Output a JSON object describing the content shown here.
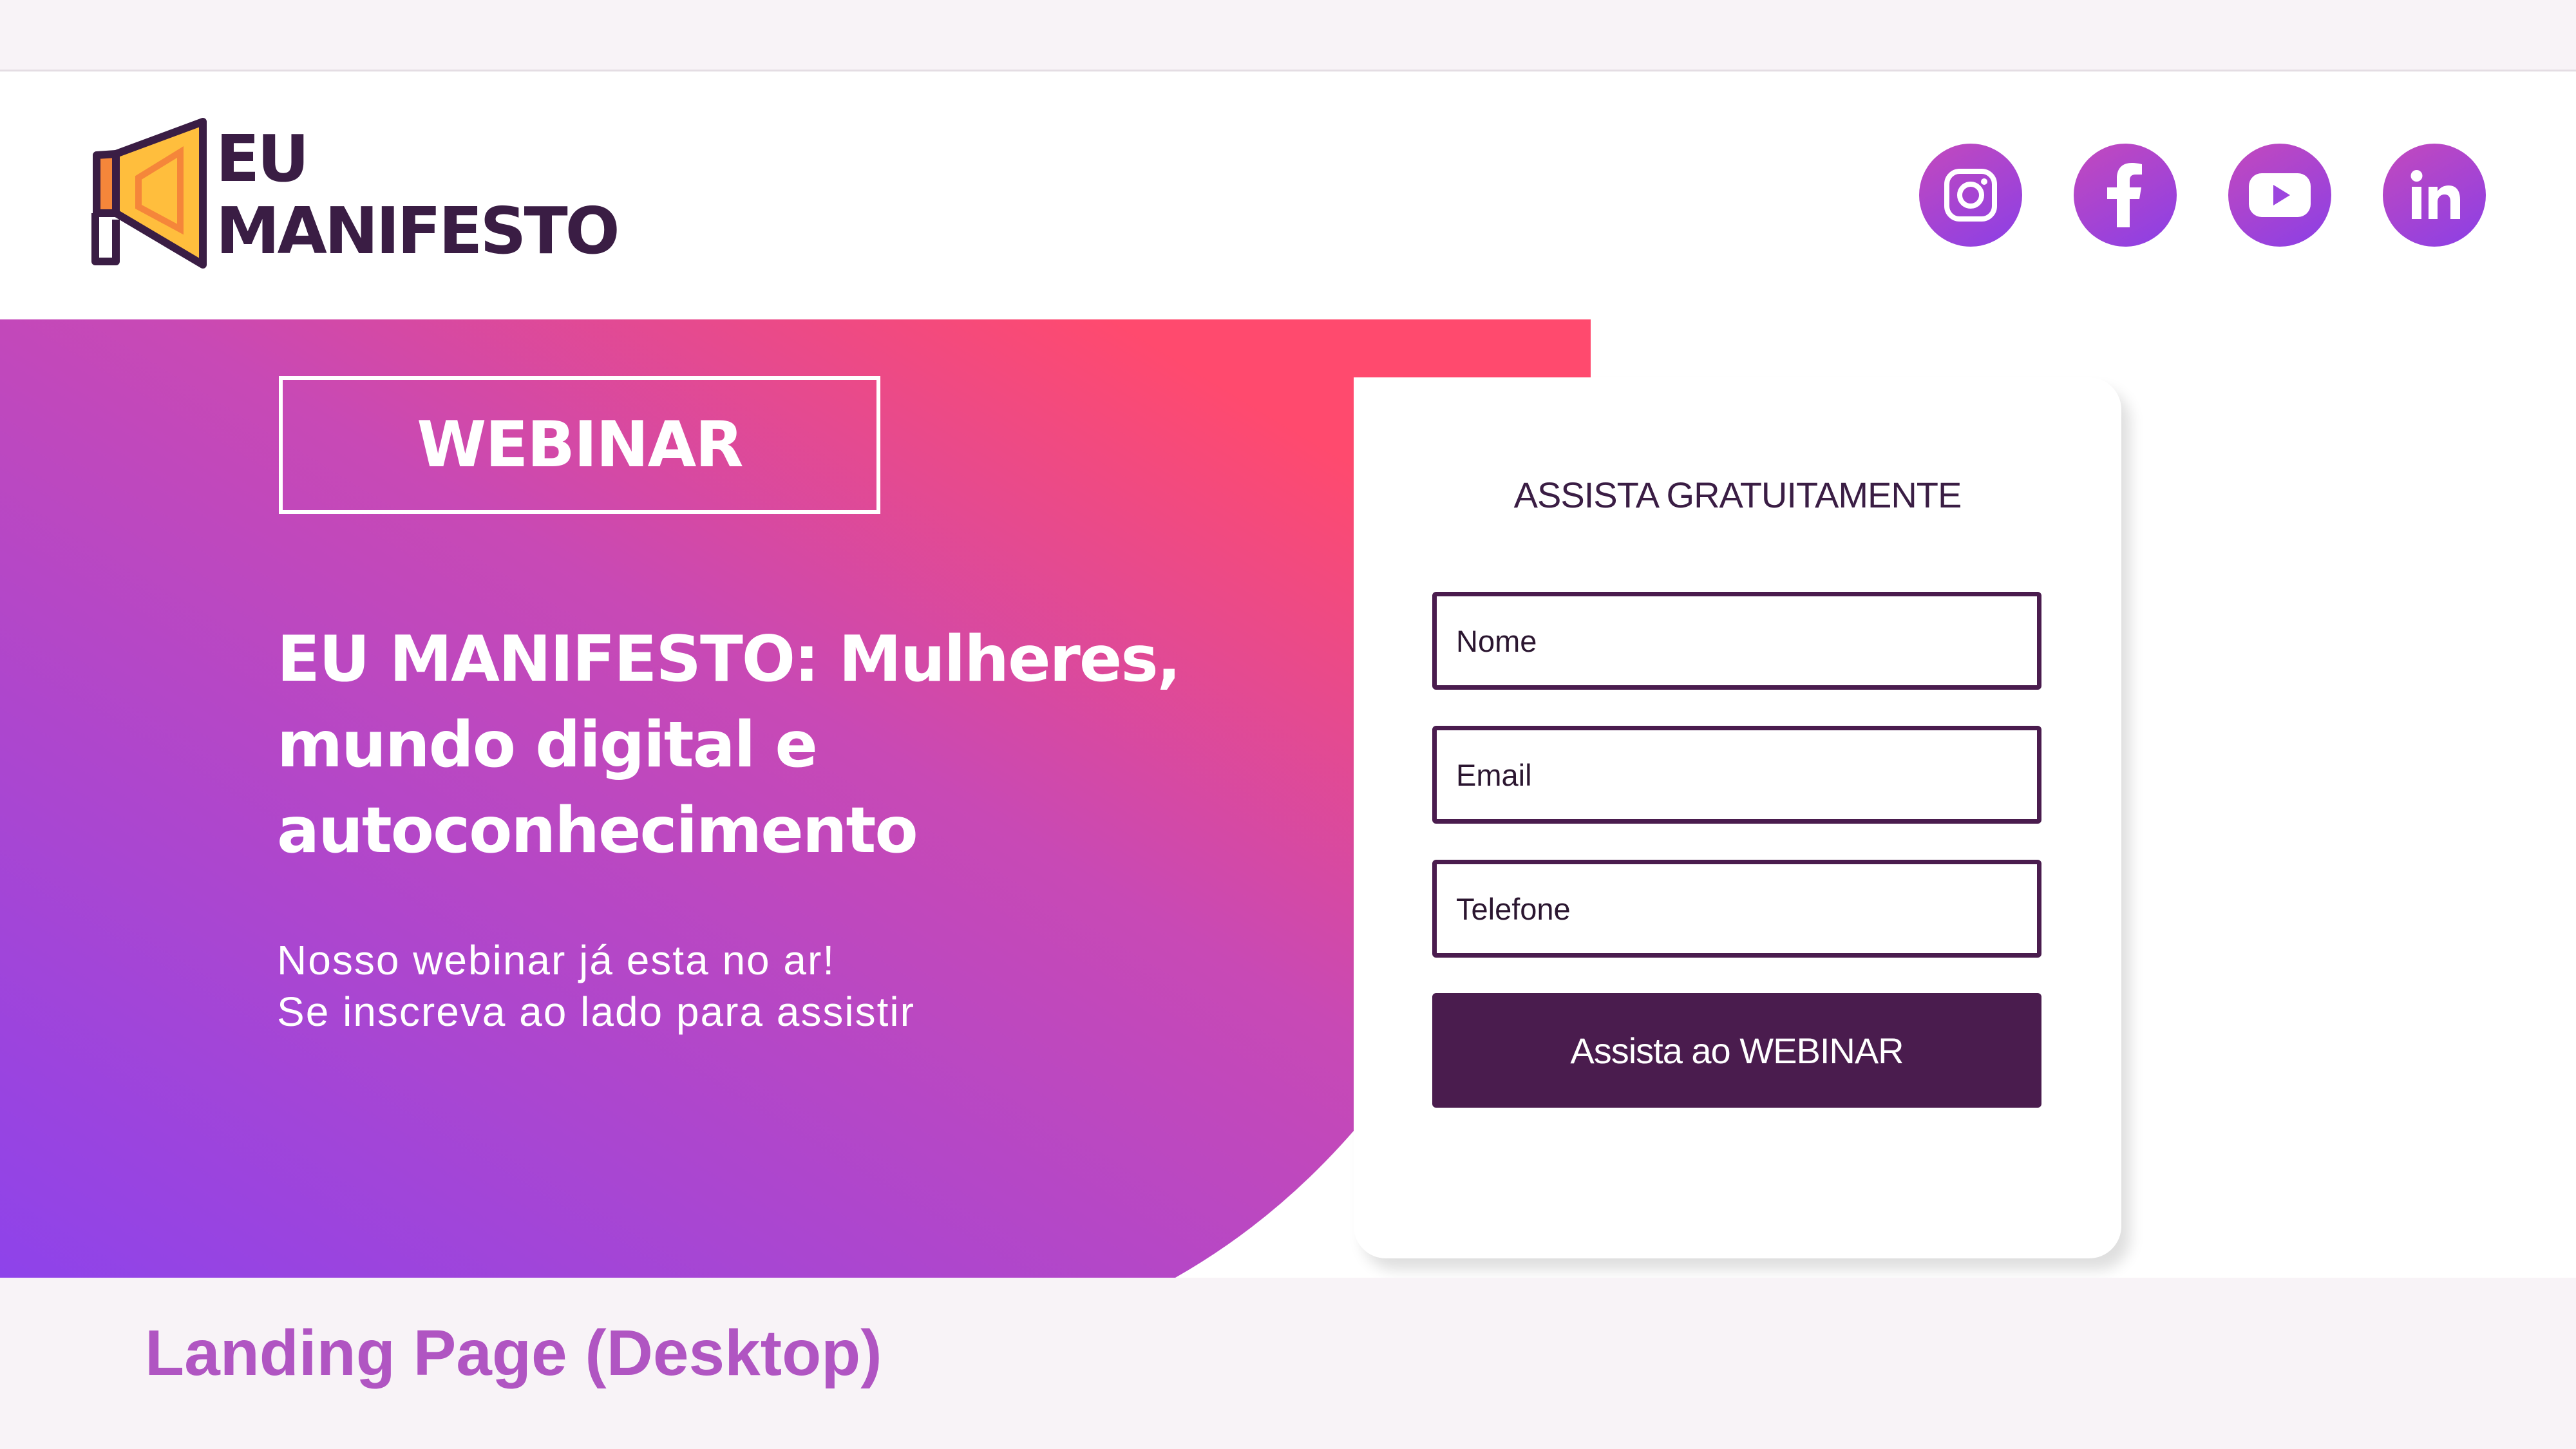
{
  "logo": {
    "line1": "EU",
    "line2": "MANIFESTO"
  },
  "socials": [
    {
      "name": "instagram",
      "icon": "instagram-icon"
    },
    {
      "name": "facebook",
      "icon": "facebook-icon"
    },
    {
      "name": "youtube",
      "icon": "youtube-icon"
    },
    {
      "name": "linkedin",
      "icon": "linkedin-icon"
    }
  ],
  "hero": {
    "badge": "WEBINAR",
    "title": "EU MANIFESTO: Mulheres, mundo digital e autoconhecimento",
    "subtitle_line1": "Nosso webinar já esta no ar!",
    "subtitle_line2": "Se inscreva ao lado para assistir"
  },
  "form": {
    "title": "ASSISTA GRATUITAMENTE",
    "name_placeholder": "Nome",
    "email_placeholder": "Email",
    "phone_placeholder": "Telefone",
    "submit_label": "Assista ao WEBINAR"
  },
  "footer": {
    "label": "Landing Page (Desktop)"
  },
  "colors": {
    "gradient_pink": "#ff4a6e",
    "gradient_magenta": "#c849b5",
    "gradient_violet": "#8e43ea",
    "button_purple": "#4a1c4e",
    "footer_text": "#b055c2",
    "logo_orange": "#f5863a",
    "logo_yellow": "#ffbe3d"
  }
}
